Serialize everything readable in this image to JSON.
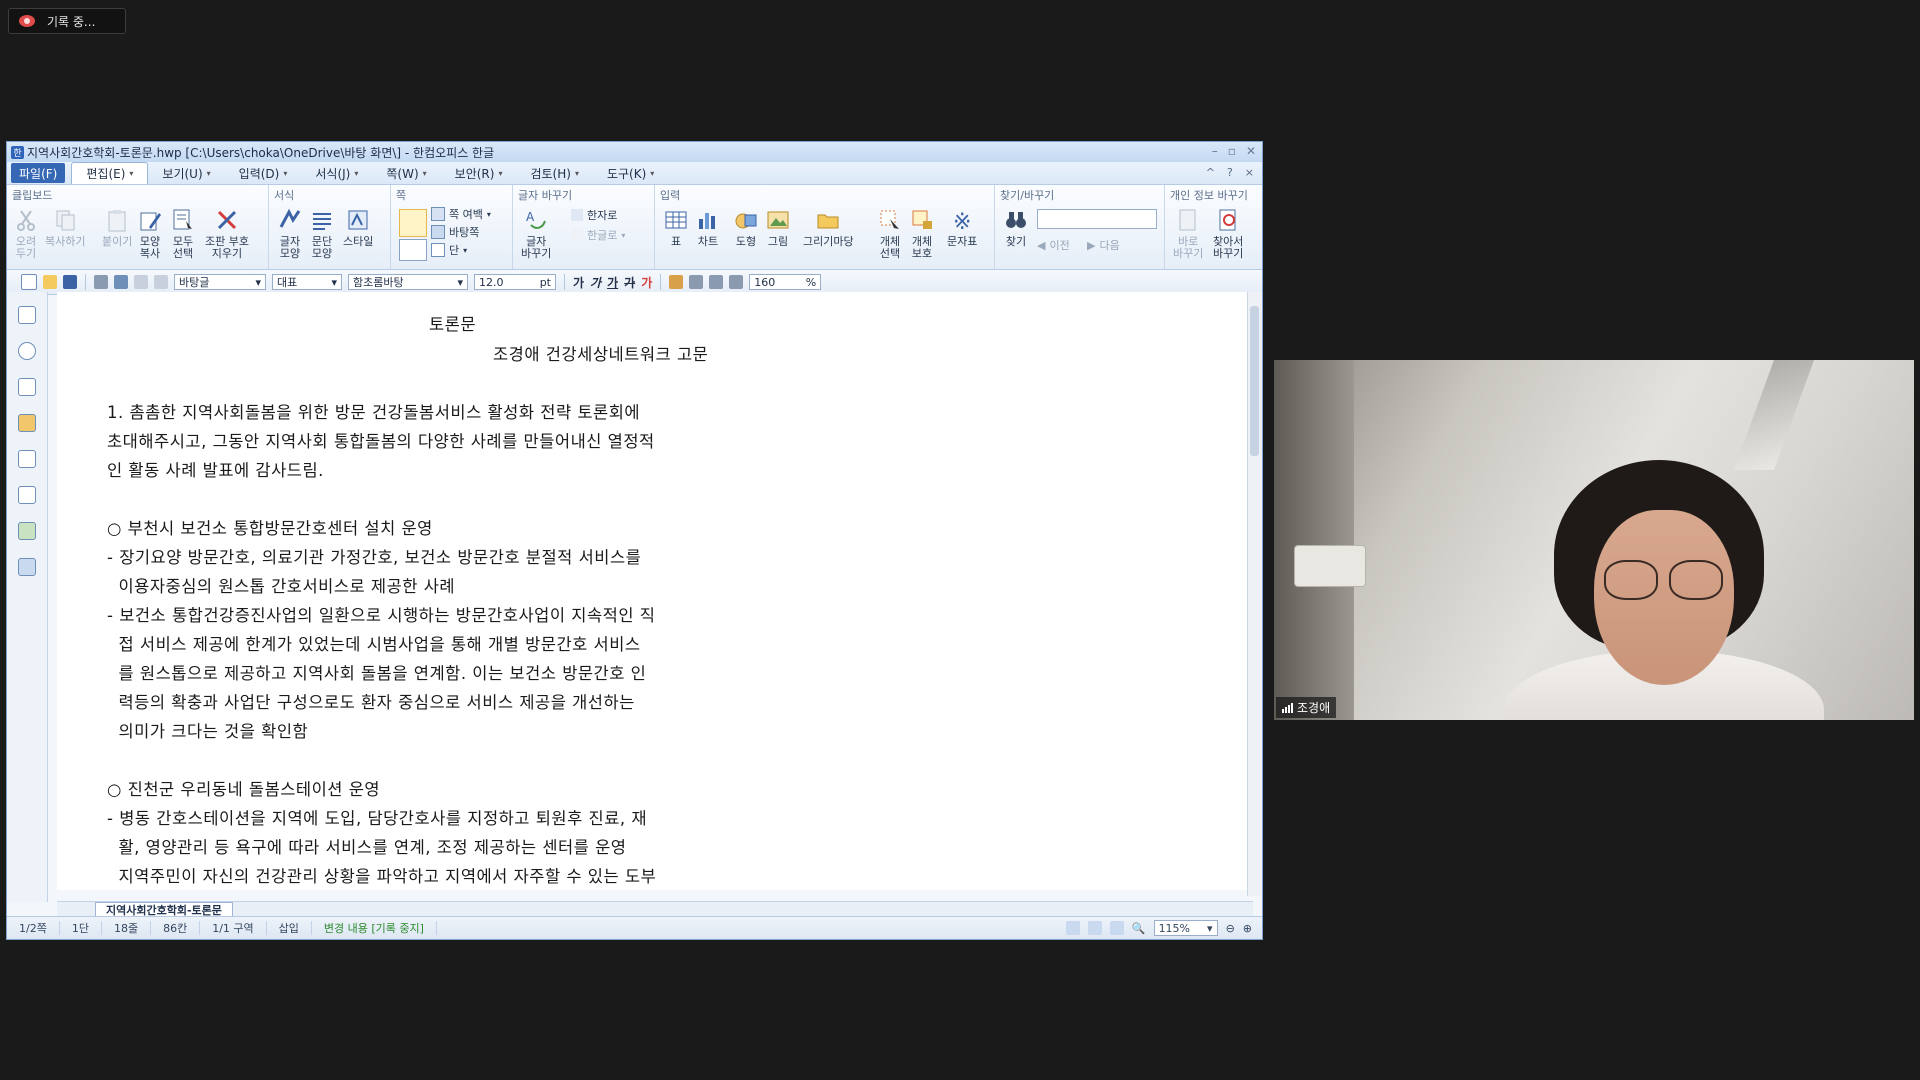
{
  "recording": {
    "label": "기록 중..."
  },
  "window": {
    "title": "지역사회간호학회-토론문.hwp [C:\\Users\\choka\\OneDrive\\바탕 화면\\] - 한컴오피스 한글",
    "controls": [
      "–",
      "▫",
      "✕"
    ]
  },
  "menu": {
    "items": [
      "파일(F)",
      "편집(E)",
      "보기(U)",
      "입력(D)",
      "서식(J)",
      "쪽(W)",
      "보안(R)",
      "검토(H)",
      "도구(K)"
    ],
    "right": [
      "^",
      "?",
      "×"
    ]
  },
  "ribbon": {
    "groups": {
      "clipboard": "클립보드",
      "format": "서식",
      "page": "쪽",
      "replace": "글자 바꾸기",
      "insert": "입력",
      "find": "찾기/바꾸기",
      "privacy": "개인 정보 바꾸기"
    },
    "buttons": {
      "cut": "오려\n두기",
      "copy": "복사하기",
      "paste": "붙이기",
      "shape_copy": "모양\n복사",
      "select_all": "모두\n선택",
      "clear_marks": "조판 부호\n지우기",
      "char_shape": "글자\n모양",
      "para_shape": "문단\n모양",
      "style": "스타일",
      "page_margin": "쪽 여백",
      "page_border": "바탕쪽",
      "columns": "단",
      "char_replace": "글자\n바꾸기",
      "hanja": "한자로",
      "hangul": "한글로",
      "table": "표",
      "chart": "차트",
      "shapes": "도형",
      "picture": "그림",
      "drawing": "그리기마당",
      "obj_select": "개체\n선택",
      "obj_protect": "개체\n보호",
      "symbol": "문자표",
      "find": "찾기",
      "prev": "이전",
      "next": "다음",
      "instant_replace": "바로\n바꾸기",
      "find_replace": "찾아서\n바꾸기"
    }
  },
  "toolbar": {
    "style_name": "바탕글",
    "representative": "대표",
    "font_name": "함초롬바탕",
    "font_size": "12.0",
    "size_unit": "pt",
    "line_spacing": "160",
    "spacing_unit": "%",
    "fmt_bold": "가",
    "fmt_italic": "가",
    "fmt_underline": "가",
    "fmt_strike": "가",
    "fmt_color": "가"
  },
  "document": {
    "title": "토론문",
    "author": "조경애 건강세상네트워크 고문",
    "lines": [
      "1. 촘촘한 지역사회돌봄을 위한 방문 건강돌봄서비스 활성화 전략 토론회에",
      "초대해주시고, 그동안 지역사회 통합돌봄의 다양한 사례를 만들어내신 열정적",
      "인 활동 사례 발표에 감사드림.",
      "",
      "○ 부천시 보건소 통합방문간호센터 설치 운영",
      "- 장기요양 방문간호, 의료기관 가정간호, 보건소 방문간호 분절적 서비스를",
      "  이용자중심의 원스톱 간호서비스로 제공한 사례",
      "- 보건소 통합건강증진사업의 일환으로 시행하는 방문간호사업이 지속적인 직",
      "  접 서비스 제공에 한계가 있었는데 시범사업을 통해 개별 방문간호 서비스",
      "  를 원스톱으로 제공하고 지역사회 돌봄을 연계함. 이는 보건소 방문간호 인",
      "  력등의 확충과 사업단 구성으로도 환자 중심으로 서비스 제공을 개선하는",
      "  의미가 크다는 것을 확인함",
      "",
      "○ 진천군 우리동네 돌봄스테이션 운영",
      "- 병동 간호스테이션을 지역에 도입, 담당간호사를 지정하고 퇴원후 진료, 재",
      "  활, 영양관리 등 욕구에 따라 서비스를 연계, 조정 제공하는 센터를 운영",
      "  지역주민이 자신의 건강관리 상황을 파악하고 지역에서 자주할 수 있는 도부"
    ]
  },
  "tabs": {
    "doc_tab": "지역사회간호학회-토론문"
  },
  "status": {
    "page": "1/2쪽",
    "column": "1단",
    "line": "18줄",
    "col": "86칸",
    "section": "1/1 구역",
    "mode": "삽입",
    "track": "변경 내용 [기록 중지]",
    "zoom": "115%"
  },
  "video": {
    "participant": "조경애"
  },
  "colors": {
    "accent": "#3567b5",
    "track": "#2c8a2c"
  }
}
